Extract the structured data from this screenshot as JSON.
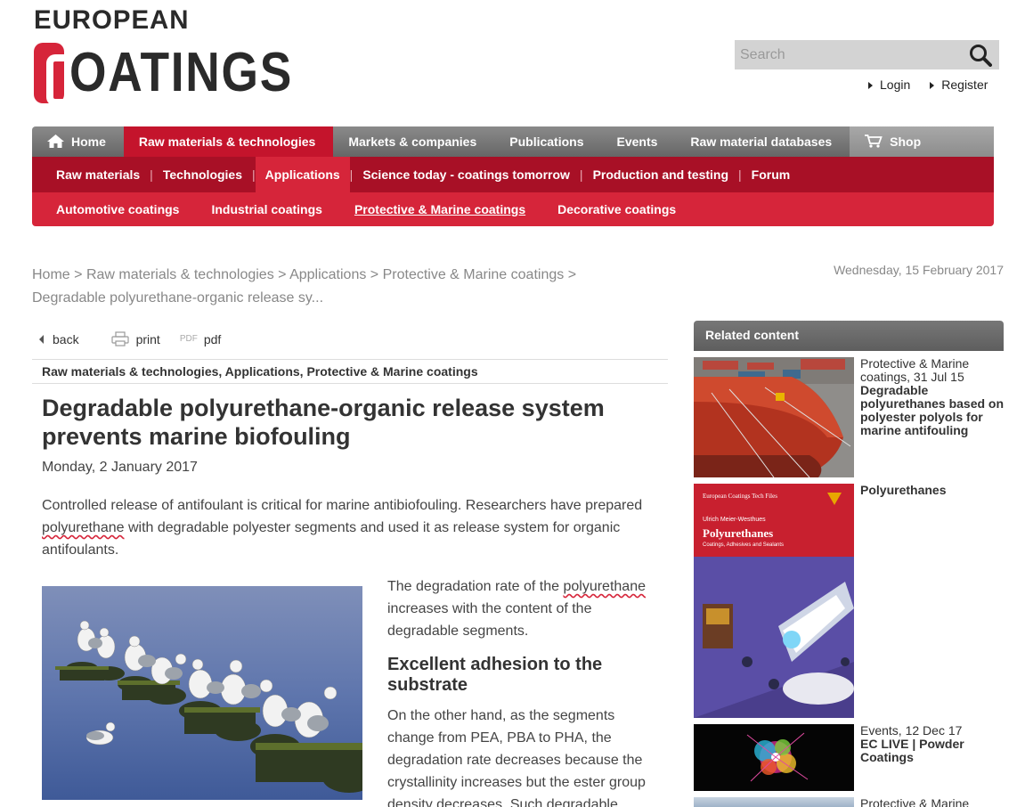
{
  "logo": {
    "top": "EUROPEAN",
    "bottom": "OATINGS"
  },
  "search": {
    "placeholder": "Search"
  },
  "auth": {
    "login": "Login",
    "register": "Register"
  },
  "nav_main": [
    {
      "label": "Home"
    },
    {
      "label": "Raw materials & technologies"
    },
    {
      "label": "Markets & companies"
    },
    {
      "label": "Publications"
    },
    {
      "label": "Events"
    },
    {
      "label": "Raw material databases"
    },
    {
      "label": "Shop"
    }
  ],
  "nav_sub": [
    {
      "label": "Raw materials"
    },
    {
      "label": "Technologies"
    },
    {
      "label": "Applications"
    },
    {
      "label": "Science today - coatings tomorrow"
    },
    {
      "label": "Production and testing"
    },
    {
      "label": "Forum"
    }
  ],
  "nav_third": [
    {
      "label": "Automotive coatings"
    },
    {
      "label": "Industrial coatings"
    },
    {
      "label": "Protective & Marine coatings"
    },
    {
      "label": "Decorative coatings"
    }
  ],
  "breadcrumb": {
    "items": [
      "Home",
      "Raw materials & technologies",
      "Applications",
      "Protective & Marine coatings"
    ],
    "sep": ">",
    "current": "Degradable polyurethane-organic release sy..."
  },
  "current_date": "Wednesday, 15 February 2017",
  "tools": {
    "back": "back",
    "print": "print",
    "pdf_tag": "PDF",
    "pdf": "pdf"
  },
  "article": {
    "categories": "Raw materials & technologies, Applications, Protective & Marine coatings",
    "title": "Degradable polyurethane-organic release system prevents marine biofouling",
    "date": "Monday, 2 January 2017",
    "lead_1": "Controlled release of antifoulant is critical for marine antibiofouling. Researchers have prepared ",
    "lead_link": "polyurethane",
    "lead_2": " with degradable polyester segments and used it as release system for organic antifoulants.",
    "p1_1": "The degradation rate of the ",
    "p1_link": "polyurethane",
    "p1_2": " increases with the content of the degradable segments.",
    "subheading": "Excellent adhesion to the substrate",
    "p2": "On the other hand, as the segments change from PEA, PBA to PHA, the degradation rate decreases because the crystallinity increases but the ester group density decreases. Such degradable"
  },
  "related": {
    "heading": "Related content",
    "items": [
      {
        "meta": "Protective & Marine coatings, 31 Jul 15",
        "title": "Degradable polyurethanes based on polyester polyols for marine antifouling"
      },
      {
        "meta": "",
        "title": "Polyurethanes",
        "book_series": "European Coatings Tech Files",
        "book_author": "Ulrich Meier-Westhues",
        "book_title": "Polyurethanes",
        "book_subtitle": "Coatings, Adhesives and Sealants"
      },
      {
        "meta": "Events, 12 Dec 17",
        "title": "EC LIVE | Powder Coatings"
      },
      {
        "meta": "Protective & Marine",
        "title": ""
      }
    ]
  },
  "colors": {
    "brand_red": "#d6253a",
    "dark_red": "#a81026",
    "nav_grey": "#777777"
  }
}
